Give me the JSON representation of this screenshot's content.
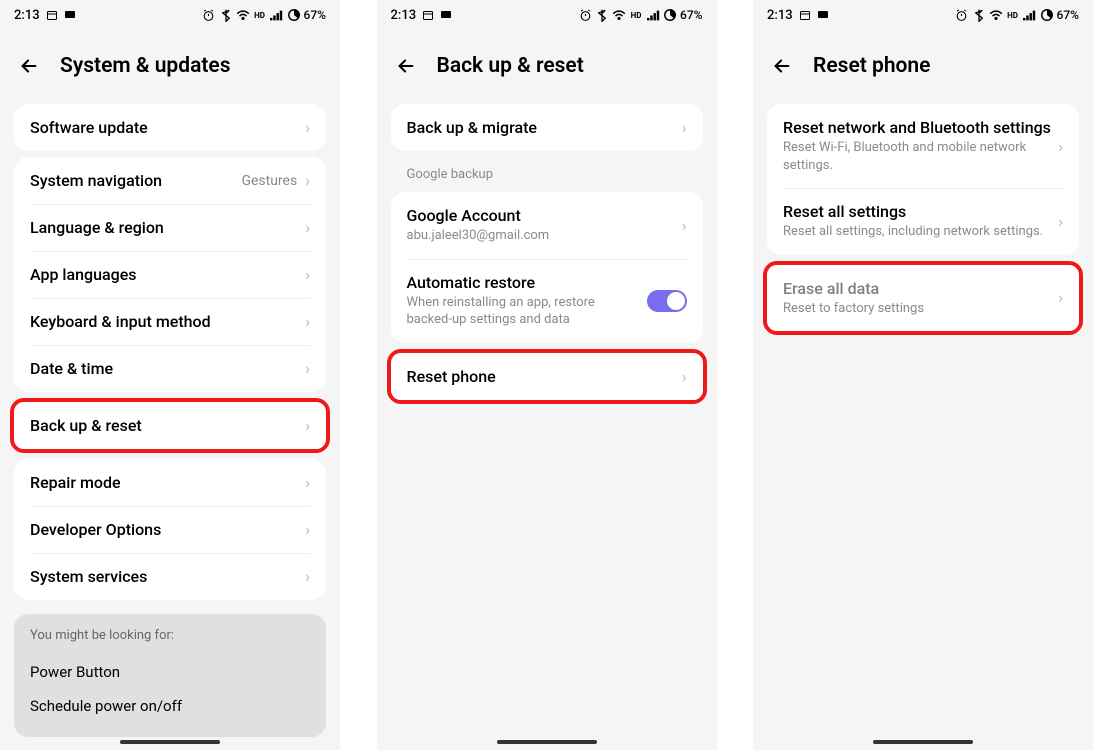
{
  "status": {
    "time": "2:13",
    "battery": "67%"
  },
  "screen1": {
    "title": "System & updates",
    "software_update": "Software update",
    "system_navigation": "System navigation",
    "system_navigation_value": "Gestures",
    "language_region": "Language & region",
    "app_languages": "App languages",
    "keyboard_input": "Keyboard & input method",
    "date_time": "Date & time",
    "backup_reset": "Back up & reset",
    "repair_mode": "Repair mode",
    "developer_options": "Developer Options",
    "system_services": "System services",
    "suggest_hint": "You might be looking for:",
    "suggest1": "Power Button",
    "suggest2": "Schedule power on/off"
  },
  "screen2": {
    "title": "Back up & reset",
    "backup_migrate": "Back up & migrate",
    "section": "Google backup",
    "google_account": "Google Account",
    "google_account_email": "abu.jaleel30@gmail.com",
    "auto_restore": "Automatic restore",
    "auto_restore_sub": "When reinstalling an app, restore backed-up settings and data",
    "reset_phone": "Reset phone"
  },
  "screen3": {
    "title": "Reset phone",
    "reset_network": "Reset network and Bluetooth settings",
    "reset_network_sub": "Reset Wi-Fi, Bluetooth and mobile network settings.",
    "reset_all": "Reset all settings",
    "reset_all_sub": "Reset all settings, including network settings.",
    "erase_all": "Erase all data",
    "erase_all_sub": "Reset to factory settings"
  }
}
